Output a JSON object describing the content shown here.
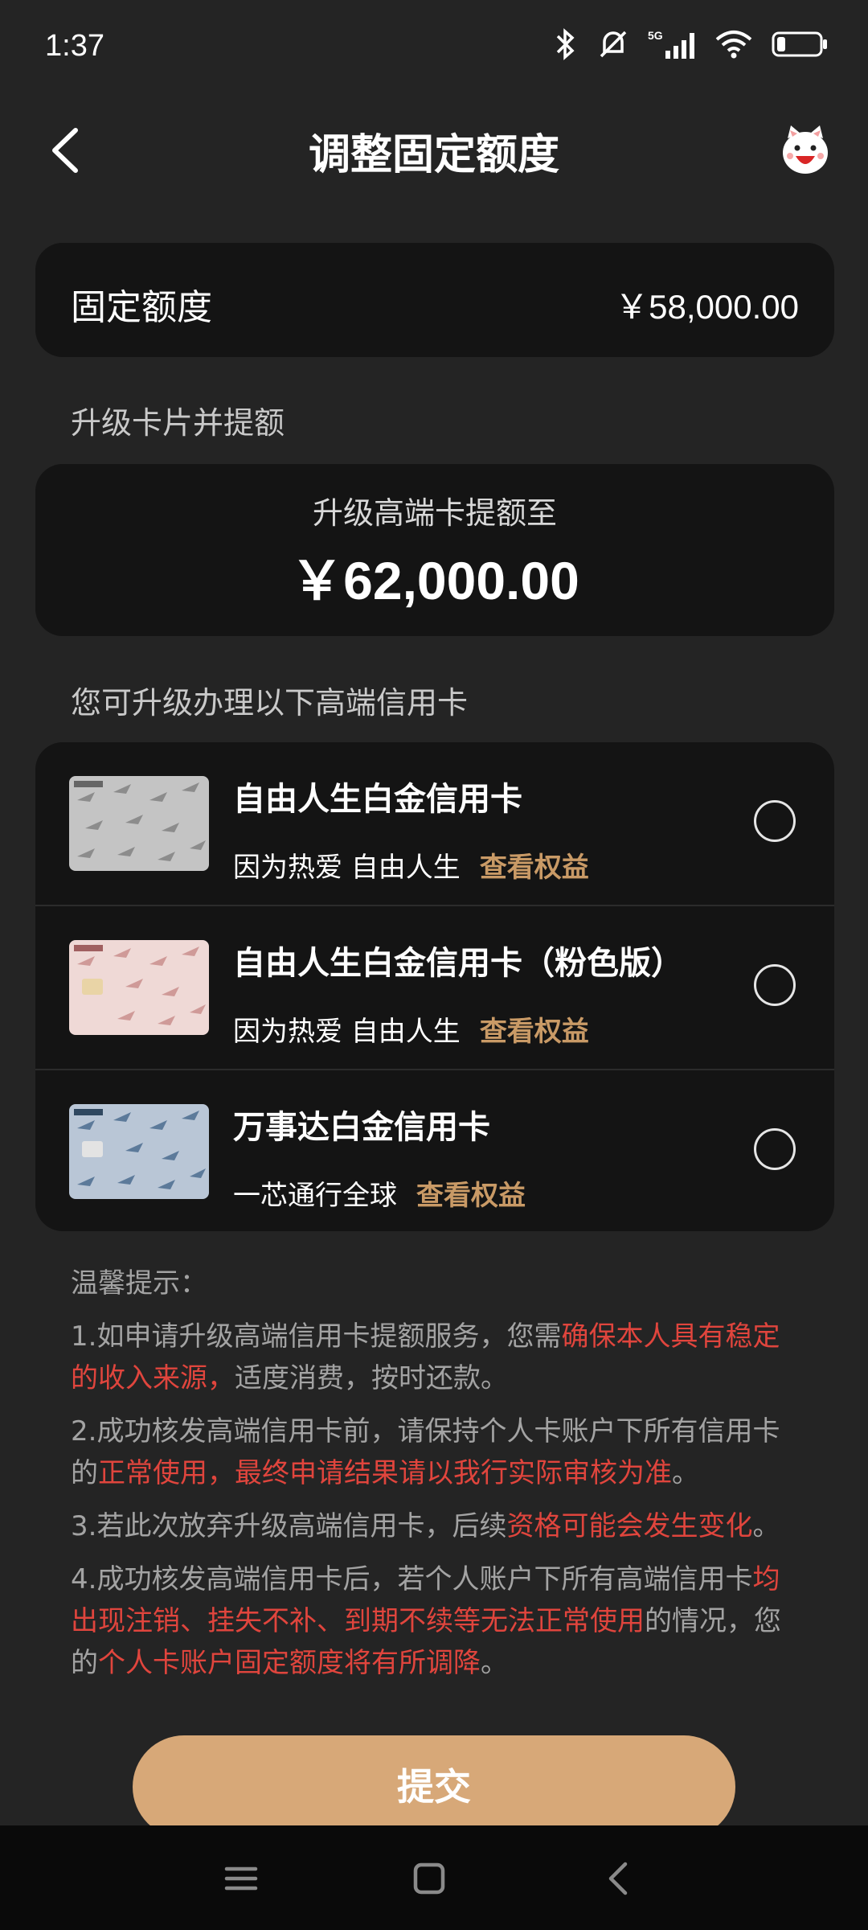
{
  "status_bar": {
    "time": "1:37",
    "network": "5G"
  },
  "header": {
    "title": "调整固定额度"
  },
  "fixed_limit": {
    "label": "固定额度",
    "amount": "￥58,000.00"
  },
  "upgrade_section": {
    "title": "升级卡片并提额",
    "subtitle": "升级高端卡提额至",
    "amount": "￥62,000.00"
  },
  "card_section": {
    "title": "您可升级办理以下高端信用卡",
    "cards": [
      {
        "name": "自由人生白金信用卡",
        "slogan": "因为热爱 自由人生",
        "link": "查看权益",
        "color": "#b8b8b8"
      },
      {
        "name": "自由人生白金信用卡（粉色版）",
        "slogan": "因为热爱 自由人生",
        "link": "查看权益",
        "color": "#e8c8c4"
      },
      {
        "name": "万事达白金信用卡",
        "slogan": "一芯通行全球",
        "link": "查看权益",
        "color": "#9fb0c4"
      }
    ]
  },
  "tips": {
    "title": "温馨提示：",
    "t1_a": "1.如申请升级高端信用卡提额服务，您需",
    "t1_b": "确保本人具有稳定的收入来源，",
    "t1_c": "适度消费，按时还款。",
    "t2_a": "2.成功核发高端信用卡前，请保持个人卡账户下所有信用卡的",
    "t2_b": "正常使用，最终申请结果请以我行实际审核为准",
    "t2_c": "。",
    "t3_a": "3.若此次放弃升级高端信用卡，后续",
    "t3_b": "资格可能会发生变化",
    "t3_c": "。",
    "t4_a": "4.成功核发高端信用卡后，若个人账户下所有高端信用卡",
    "t4_b": "均出现注销、挂失不补、到期不续等无法正常使用",
    "t4_c": "的情况，您的",
    "t4_d": "个人卡账户固定额度将有所调降",
    "t4_e": "。"
  },
  "submit": {
    "label": "提交"
  },
  "colors": {
    "accent": "#d7a878",
    "link": "#c99a66",
    "warning": "#e0453d",
    "background": "#242424",
    "panel": "#141414"
  }
}
